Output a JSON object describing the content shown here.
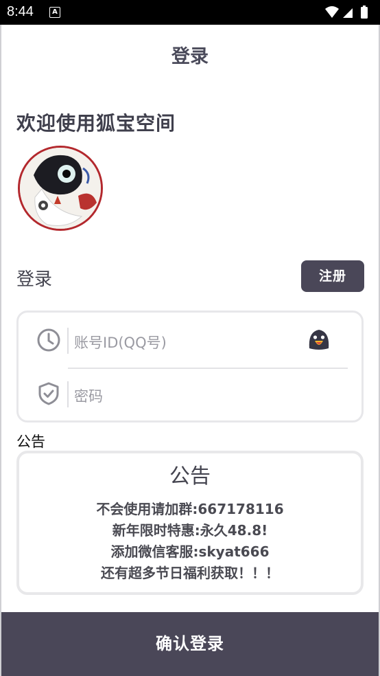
{
  "status_bar": {
    "time": "8:44",
    "notification_badge": "A"
  },
  "header": {
    "title": "登录"
  },
  "welcome": {
    "text": "欢迎使用狐宝空间"
  },
  "login_section": {
    "label": "登录",
    "register_button": "注册"
  },
  "form": {
    "account_placeholder": "账号ID(QQ号)",
    "password_placeholder": "密码",
    "icons": [
      "clock-icon",
      "qq-penguin-icon",
      "shield-check-icon"
    ]
  },
  "notice": {
    "heading": "公告",
    "title": "公告",
    "lines": [
      "不会使用请加群:667178116",
      "新年限时特惠:永久48.8!",
      "添加微信客服:skyat666",
      "还有超多节日福利获取！！！"
    ]
  },
  "confirm_button": "确认登录",
  "colors": {
    "primary_dark": "#4a4758",
    "text_dark": "#44444f",
    "border": "#e7e7ea"
  }
}
